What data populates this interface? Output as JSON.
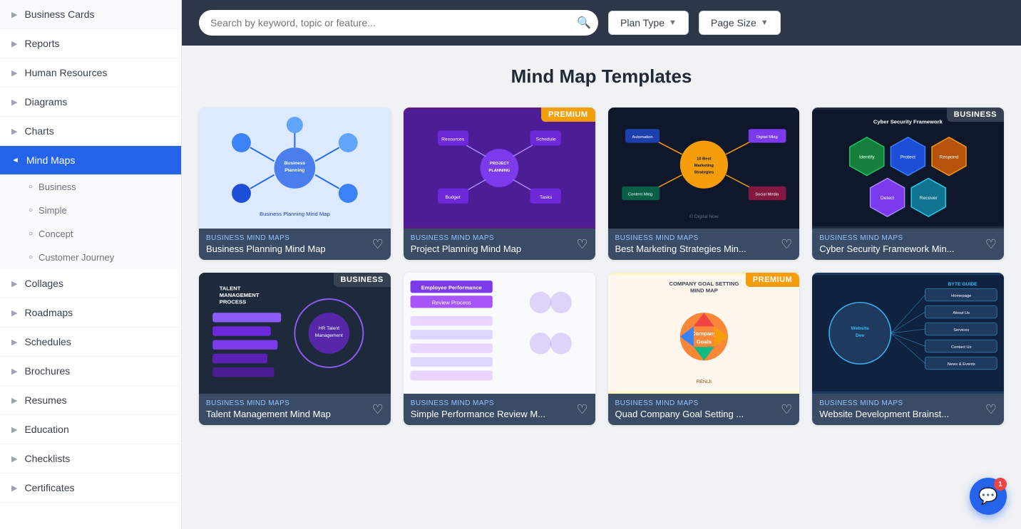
{
  "sidebar": {
    "items": [
      {
        "id": "business-cards",
        "label": "Business Cards",
        "expanded": false,
        "active": false
      },
      {
        "id": "reports",
        "label": "Reports",
        "expanded": false,
        "active": false
      },
      {
        "id": "human-resources",
        "label": "Human Resources",
        "expanded": false,
        "active": false
      },
      {
        "id": "diagrams",
        "label": "Diagrams",
        "expanded": false,
        "active": false
      },
      {
        "id": "charts",
        "label": "Charts",
        "expanded": false,
        "active": false
      },
      {
        "id": "mind-maps",
        "label": "Mind Maps",
        "expanded": true,
        "active": true
      },
      {
        "id": "collages",
        "label": "Collages",
        "expanded": false,
        "active": false
      },
      {
        "id": "roadmaps",
        "label": "Roadmaps",
        "expanded": false,
        "active": false
      },
      {
        "id": "schedules",
        "label": "Schedules",
        "expanded": false,
        "active": false
      },
      {
        "id": "brochures",
        "label": "Brochures",
        "expanded": false,
        "active": false
      },
      {
        "id": "resumes",
        "label": "Resumes",
        "expanded": false,
        "active": false
      },
      {
        "id": "education",
        "label": "Education",
        "expanded": false,
        "active": false
      },
      {
        "id": "checklists",
        "label": "Checklists",
        "expanded": false,
        "active": false
      },
      {
        "id": "certificates",
        "label": "Certificates",
        "expanded": false,
        "active": false
      }
    ],
    "sub_items": [
      {
        "id": "business",
        "label": "Business"
      },
      {
        "id": "simple",
        "label": "Simple"
      },
      {
        "id": "concept",
        "label": "Concept"
      },
      {
        "id": "customer-journey",
        "label": "Customer Journey"
      }
    ]
  },
  "toolbar": {
    "search_placeholder": "Search by keyword, topic or feature...",
    "plan_type_label": "Plan Type",
    "page_size_label": "Page Size"
  },
  "main": {
    "title": "Mind Map Templates",
    "cards": [
      {
        "id": "card-1",
        "category": "Business Mind Maps",
        "title": "Business Planning Mind Map",
        "badge": "",
        "thumb_bg": "#dbeafe",
        "thumb_color": "#1d4ed8",
        "thumb_label": "Business Planning Mind Map"
      },
      {
        "id": "card-2",
        "category": "Business Mind Maps",
        "title": "Project Planning Mind Map",
        "badge": "PREMIUM",
        "thumb_bg": "#581c87",
        "thumb_color": "#a855f7",
        "thumb_label": "Project Planning Mind Map"
      },
      {
        "id": "card-3",
        "category": "Business Mind Maps",
        "title": "Best Marketing Strategies Min...",
        "badge": "",
        "thumb_bg": "#0f172a",
        "thumb_color": "#f59e0b",
        "thumb_label": "Best Marketing Strategies"
      },
      {
        "id": "card-4",
        "category": "Business Mind Maps",
        "title": "Cyber Security Framework Min...",
        "badge": "BUSINESS",
        "thumb_bg": "#1e293b",
        "thumb_color": "#22d3ee",
        "thumb_label": "Cyber Security Framework"
      },
      {
        "id": "card-5",
        "category": "Business Mind Maps",
        "title": "Talent Management Mind Map",
        "badge": "BUSINESS",
        "thumb_bg": "#1e293b",
        "thumb_color": "#8b5cf6",
        "thumb_label": "Talent Management"
      },
      {
        "id": "card-6",
        "category": "Business Mind Maps",
        "title": "Simple Performance Review M...",
        "badge": "",
        "thumb_bg": "#f8fafc",
        "thumb_color": "#7c3aed",
        "thumb_label": "Employee Performance Review"
      },
      {
        "id": "card-7",
        "category": "Business Mind Maps",
        "title": "Quad Company Goal Setting ...",
        "badge": "PREMIUM",
        "thumb_bg": "#fef3c7",
        "thumb_color": "#d97706",
        "thumb_label": "Company Goal Setting Mind Map"
      },
      {
        "id": "card-8",
        "category": "Business Mind Maps",
        "title": "Website Development Brainst...",
        "badge": "",
        "thumb_bg": "#1e3a5f",
        "thumb_color": "#38bdf8",
        "thumb_label": "Website Development Brainstorm"
      }
    ]
  },
  "chat": {
    "notification_count": "1"
  }
}
